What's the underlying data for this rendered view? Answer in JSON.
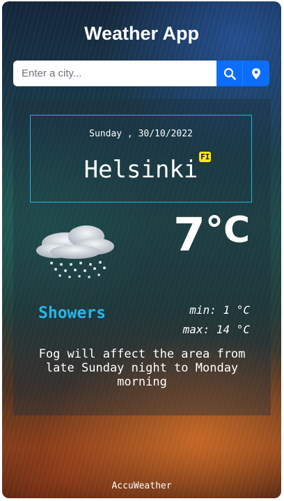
{
  "header": {
    "title": "Weather App"
  },
  "search": {
    "placeholder": "Enter a city...",
    "value": ""
  },
  "weather": {
    "date": "Sunday , 30/10/2022",
    "city": "Helsinki",
    "country": "FI",
    "temperature": "7",
    "unit": "°C",
    "condition": "Showers",
    "min": "min: 1 °C",
    "max": "max: 14 °C",
    "description": "Fog will affect the area from late Sunday night to Monday morning"
  },
  "footer": {
    "credit": "AccuWeather"
  },
  "colors": {
    "accent": "#0d6efd",
    "condition": "#29b5ec",
    "border": "#1fb6e6",
    "badge": "#ffeb00"
  }
}
